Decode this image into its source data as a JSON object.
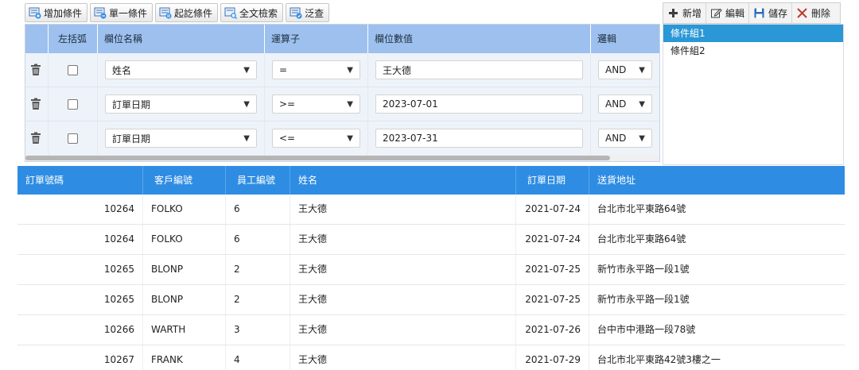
{
  "toolbar": {
    "add_condition": "增加條件",
    "single_condition": "單一條件",
    "range_condition": "起訖條件",
    "fulltext_search": "全文檢索",
    "generic_query": "泛查"
  },
  "group_toolbar": {
    "new_label": "新增",
    "edit_label": "編輯",
    "save_label": "儲存",
    "delete_label": "刪除"
  },
  "condition_grid": {
    "headers": {
      "left_paren": "左括弧",
      "field_name": "欄位名稱",
      "operator": "運算子",
      "field_value": "欄位數值",
      "logic": "邏輯"
    },
    "rows": [
      {
        "field": "姓名",
        "operator": "=",
        "value": "王大德",
        "logic": "AND"
      },
      {
        "field": "訂單日期",
        "operator": ">=",
        "value": "2023-07-01",
        "logic": "AND"
      },
      {
        "field": "訂單日期",
        "operator": "<=",
        "value": "2023-07-31",
        "logic": "AND"
      }
    ]
  },
  "condition_groups": {
    "items": [
      "條件組1",
      "條件組2"
    ],
    "selected": "條件組1"
  },
  "data_table": {
    "headers": {
      "order_id": "訂單號碼",
      "customer_id": "客戶編號",
      "employee_id": "員工編號",
      "name": "姓名",
      "order_date": "訂單日期",
      "ship_address": "送貨地址"
    },
    "rows": [
      {
        "order_id": "10264",
        "customer_id": "FOLKO",
        "employee_id": "6",
        "name": "王大德",
        "order_date": "2021-07-24",
        "ship_address": "台北市北平東路64號"
      },
      {
        "order_id": "10264",
        "customer_id": "FOLKO",
        "employee_id": "6",
        "name": "王大德",
        "order_date": "2021-07-24",
        "ship_address": "台北市北平東路64號"
      },
      {
        "order_id": "10265",
        "customer_id": "BLONP",
        "employee_id": "2",
        "name": "王大德",
        "order_date": "2021-07-25",
        "ship_address": "新竹市永平路一段1號"
      },
      {
        "order_id": "10265",
        "customer_id": "BLONP",
        "employee_id": "2",
        "name": "王大德",
        "order_date": "2021-07-25",
        "ship_address": "新竹市永平路一段1號"
      },
      {
        "order_id": "10266",
        "customer_id": "WARTH",
        "employee_id": "3",
        "name": "王大德",
        "order_date": "2021-07-26",
        "ship_address": "台中市中港路一段78號"
      },
      {
        "order_id": "10267",
        "customer_id": "FRANK",
        "employee_id": "4",
        "name": "王大德",
        "order_date": "2021-07-29",
        "ship_address": "台北市北平東路42號3樓之一"
      }
    ]
  },
  "colors": {
    "condition_header": "#9dc0ee",
    "condition_row": "#eef3fa",
    "table_header": "#2e8de3",
    "group_selected": "#2a97d6"
  }
}
